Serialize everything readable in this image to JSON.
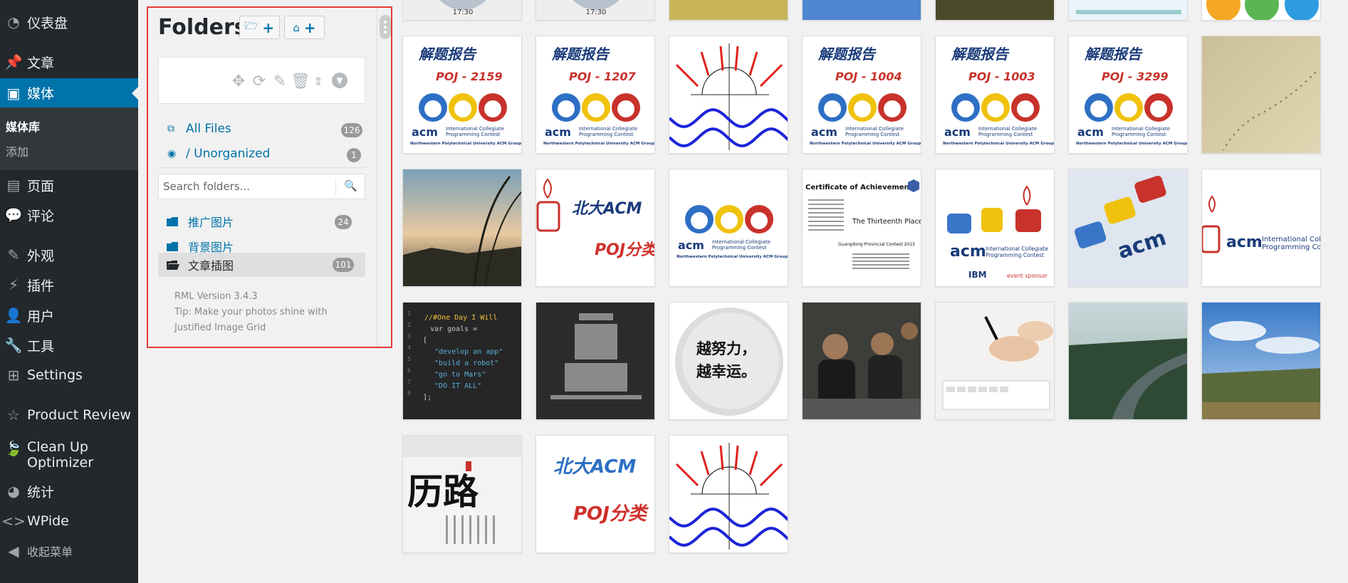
{
  "admin_menu": {
    "items": [
      {
        "label": "仪表盘",
        "icon": "dashboard-icon"
      },
      {
        "label": "文章",
        "icon": "pin-icon"
      },
      {
        "label": "媒体",
        "icon": "media-icon"
      },
      {
        "label": "页面",
        "icon": "page-icon"
      },
      {
        "label": "评论",
        "icon": "comment-icon"
      },
      {
        "label": "外观",
        "icon": "brush-icon"
      },
      {
        "label": "插件",
        "icon": "plugin-icon"
      },
      {
        "label": "用户",
        "icon": "user-icon"
      },
      {
        "label": "工具",
        "icon": "wrench-icon"
      },
      {
        "label": "Settings",
        "icon": "settings-icon"
      },
      {
        "label": "Product Review",
        "icon": "star-icon"
      },
      {
        "label": "Clean Up Optimizer",
        "icon": "leaf-icon"
      },
      {
        "label": "统计",
        "icon": "pie-icon"
      },
      {
        "label": "WPide",
        "icon": "code-icon"
      },
      {
        "label": "收起菜单",
        "icon": "collapse-icon"
      }
    ],
    "submenu": {
      "library": "媒体库",
      "add": "添加"
    }
  },
  "folders": {
    "title": "Folders",
    "all_files": {
      "label": "All Files",
      "count": "126"
    },
    "unorganized": {
      "label": "/ Unorganized",
      "count": "1"
    },
    "search_placeholder": "Search folders...",
    "items": [
      {
        "label": "推广图片",
        "count": "24"
      },
      {
        "label": "背景图片",
        "count": ""
      },
      {
        "label": "文章插图",
        "count": "101"
      }
    ],
    "footer": {
      "version": "RML Version 3.4.3",
      "tip": "Tip: Make your photos shine with Justified Image Grid"
    }
  },
  "media": {
    "top_clock_text": "17:30",
    "report_title": "解题报告",
    "report_codes": [
      "POJ - 2159",
      "POJ - 1207",
      "POJ - 1004",
      "POJ - 1003",
      "POJ - 3299"
    ],
    "acm_logo_text": "acm",
    "acm_contest_lines": [
      "International Collegiate",
      "Programming Contest"
    ],
    "acm_group": "Northwestern Polytechnical University ACM Group",
    "pku_text": "北大ACM",
    "poj_category": "POJ分类",
    "certificate": {
      "title": "Certificate of Achievement",
      "place": "The Thirteenth Place",
      "contest": "Guangdong Provincial Contest 2013"
    },
    "event_sponsor": "event sponsor",
    "ibm": "IBM",
    "code_lines": [
      "//#One Day I Will",
      "var goals =",
      "[",
      "\"develop an app\"",
      "\"build a robot\"",
      "\"go to Mars\"",
      "\"DO IT ALL\"",
      "];"
    ],
    "motto": [
      "越努力，",
      "越幸运。"
    ],
    "calligraphy": "历路"
  }
}
